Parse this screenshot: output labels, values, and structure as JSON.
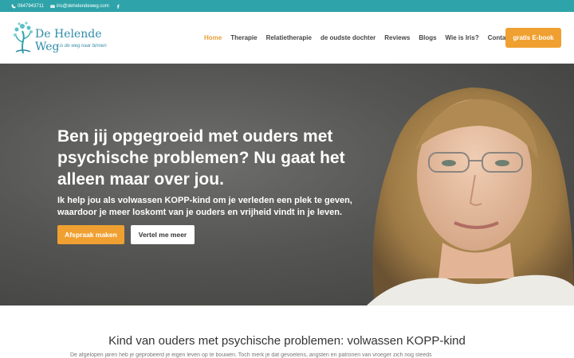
{
  "topbar": {
    "phone": "0647943711",
    "email": "iris@dehelendeweg.com",
    "icons": [
      "phone-icon",
      "mail-icon",
      "facebook-icon"
    ]
  },
  "logo": {
    "title": "De Helende Weg",
    "tagline": "...is de weg naar binnen"
  },
  "nav": {
    "items": [
      "Home",
      "Therapie",
      "Relatietherapie",
      "de oudste dochter",
      "Reviews",
      "Blogs",
      "Wie is Iris?",
      "Contact"
    ],
    "active": "Home",
    "cta": "gratis E-book"
  },
  "hero": {
    "heading": "Ben jij opgegroeid met ouders met psychische problemen? Nu gaat het alleen maar over jou.",
    "subtext": "Ik help jou als volwassen KOPP-kind om je verleden een plek te geven, waardoor je meer loskomt van je ouders en vrijheid vindt in je leven.",
    "primary_button": "Afspraak maken",
    "secondary_button": "Vertel me meer"
  },
  "section": {
    "title": "Kind van ouders met psychische problemen: volwassen KOPP-kind",
    "text": "De afgelopen jaren heb je geprobeerd je eigen leven op te bouwen. Toch merk je dat gevoelens, angsten en patronen van vroeger zich nog steeds"
  },
  "colors": {
    "topbar": "#2ea3a9",
    "accent": "#f0a030",
    "nav_active": "#e8a13b",
    "logo": "#2e8ba8"
  }
}
